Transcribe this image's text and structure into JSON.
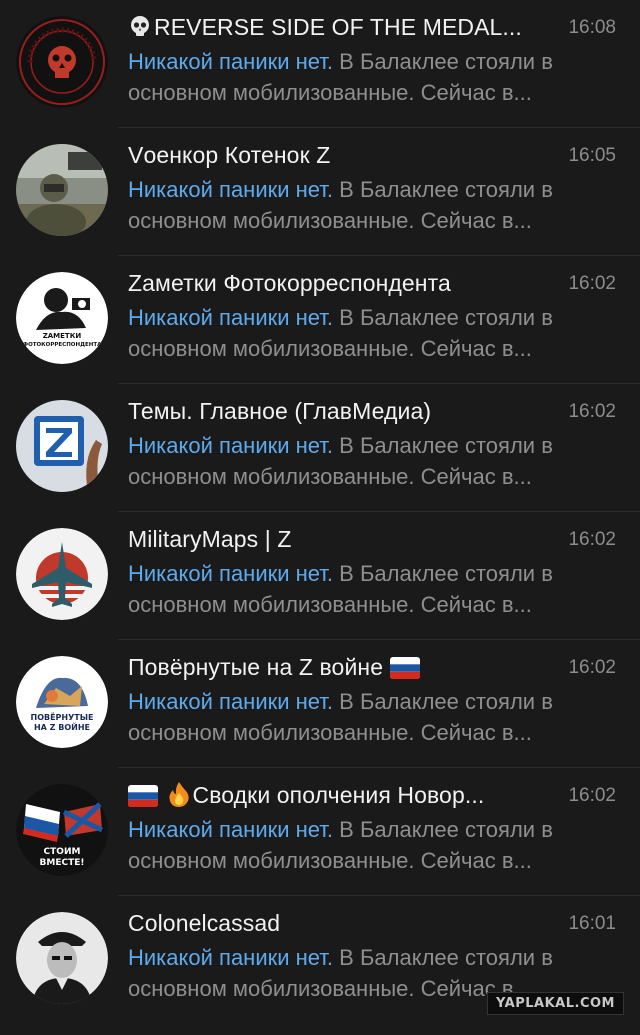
{
  "chats": [
    {
      "title": "REVERSE SIDE OF THE MEDAL...",
      "title_prefix_icon": "skull-emoji",
      "time": "16:08",
      "preview_sender": "Никакой паники нет.",
      "preview_text": " В Балаклее стояли в основном мобилизованные. Сейчас в...",
      "avatar": "skull-logo-avatar"
    },
    {
      "title": "Vоенкор Котенок Z",
      "time": "16:05",
      "preview_sender": "Никакой паники нет.",
      "preview_text": " В Балаклее стояли в основном мобилизованные. Сейчас в...",
      "avatar": "soldier-photo-avatar"
    },
    {
      "title": "Zаметки Фотокорреспондента",
      "time": "16:02",
      "preview_sender": "Никакой паники нет.",
      "preview_text": " В Балаклее стояли в основном мобилизованные. Сейчас в...",
      "avatar": "photographer-logo-avatar",
      "avatar_caption_1": "ZАМЕТКИ",
      "avatar_caption_2": "ФОТОКОРРЕСПОНДЕНТА"
    },
    {
      "title": "Темы. Главное (ГлавМедиа)",
      "time": "16:02",
      "preview_sender": "Никакой паники нет.",
      "preview_text": " В Балаклее стояли в основном мобилизованные. Сейчас в...",
      "avatar": "z-letter-avatar"
    },
    {
      "title": "MilitaryMaps | Z",
      "time": "16:02",
      "preview_sender": "Никакой паники нет.",
      "preview_text": " В Балаклее стояли в основном мобилизованные. Сейчас в...",
      "avatar": "fighter-jet-avatar"
    },
    {
      "title": "Повёрнутые на Z войне",
      "title_suffix_icon": "russia-flag-emoji",
      "time": "16:02",
      "preview_sender": "Никакой паники нет.",
      "preview_text": " В Балаклее стояли в основном мобилизованные. Сейчас в...",
      "avatar": "povernutye-avatar",
      "avatar_caption_1": "ПОВЁРНУТЫЕ",
      "avatar_caption_2": "НА Z ВОЙНЕ"
    },
    {
      "title": "Сводки ополчения Новор...",
      "title_prefix_icons": [
        "russia-flag-emoji",
        "fire-emoji"
      ],
      "time": "16:02",
      "preview_sender": "Никакой паники нет.",
      "preview_text": " В Балаклее стояли в основном мобилизованные. Сейчас в...",
      "avatar": "flags-avatar",
      "avatar_caption_1": "СТОИМ",
      "avatar_caption_2": "ВМЕСТЕ!"
    },
    {
      "title": "Colonelcassad",
      "time": "16:01",
      "preview_sender": "Никакой паники нет.",
      "preview_text": " В Балаклее стояли в основном мобилизованные. Сейчас в...",
      "avatar": "officer-portrait-avatar"
    }
  ],
  "watermark": "YAPLAKAL.COM",
  "colors": {
    "background": "#1a1a1a",
    "title": "#f2f2f2",
    "time": "#8c8c8c",
    "preview": "#8f8f8f",
    "sender": "#5fa9ec"
  }
}
